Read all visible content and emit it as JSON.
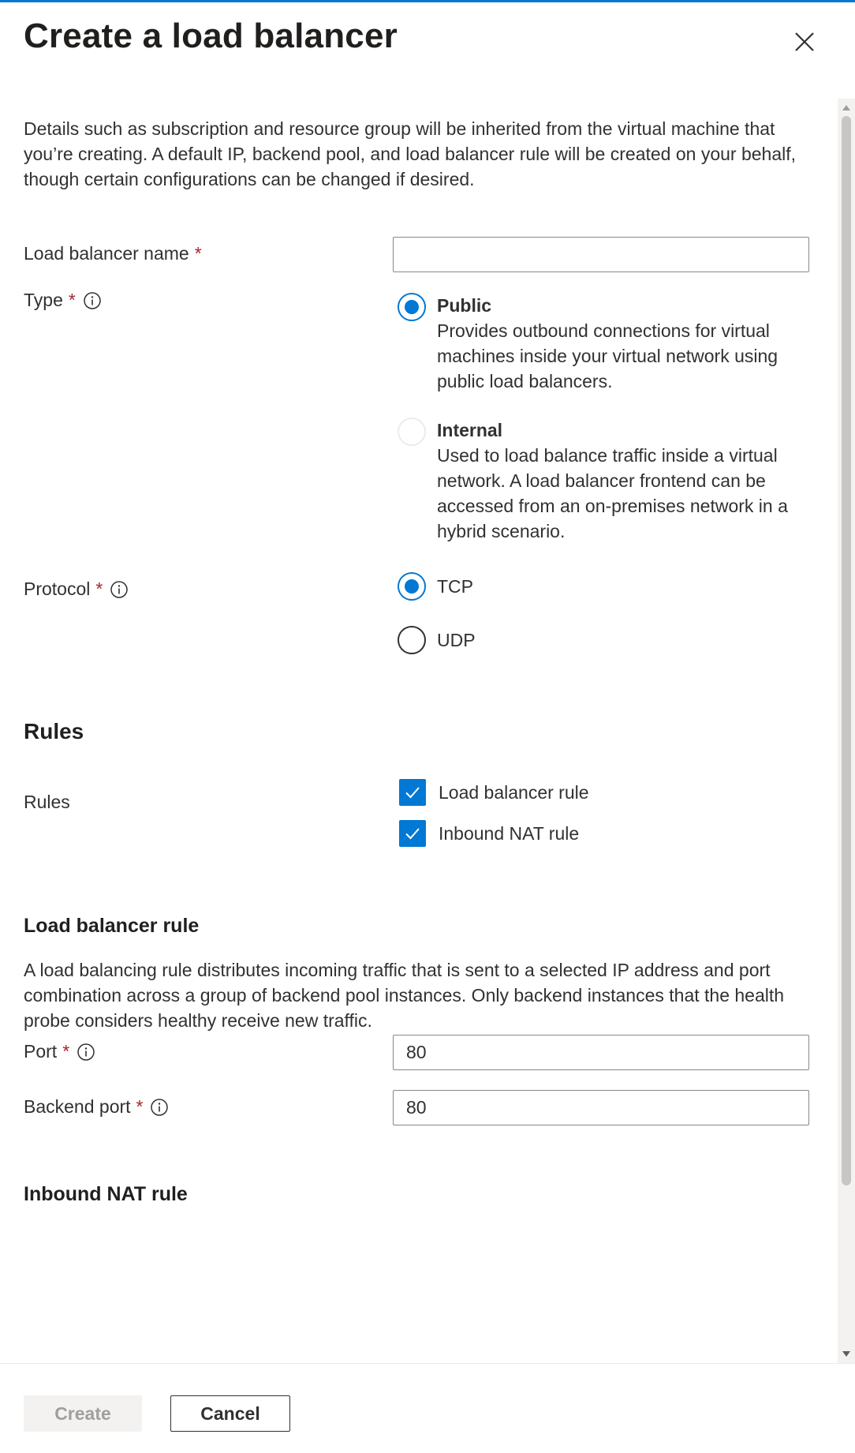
{
  "header": {
    "title": "Create a load balancer",
    "close_icon": "close-icon"
  },
  "intro": "Details such as subscription and resource group will be inherited from the virtual machine that you’re creating. A default IP, backend pool, and load balancer rule will be created on your behalf, though certain configurations can be changed if desired.",
  "form": {
    "name": {
      "label": "Load balancer name",
      "required": "*",
      "value": ""
    },
    "type": {
      "label": "Type",
      "required": "*",
      "info_icon": "info-icon",
      "options": [
        {
          "title": "Public",
          "desc": "Provides outbound connections for virtual machines inside your virtual network using public load balancers.",
          "selected": true
        },
        {
          "title": "Internal",
          "desc": "Used to load balance traffic inside a virtual network. A load balancer frontend can be accessed from an on-premises network in a hybrid scenario.",
          "selected": false
        }
      ]
    },
    "protocol": {
      "label": "Protocol",
      "required": "*",
      "info_icon": "info-icon",
      "options": [
        {
          "label": "TCP",
          "selected": true
        },
        {
          "label": "UDP",
          "selected": false
        }
      ]
    }
  },
  "rules_section": {
    "heading": "Rules",
    "label": "Rules",
    "items": [
      {
        "label": "Load balancer rule",
        "checked": true
      },
      {
        "label": "Inbound NAT rule",
        "checked": true
      }
    ]
  },
  "lb_rule": {
    "heading": "Load balancer rule",
    "desc": "A load balancing rule distributes incoming traffic that is sent to a selected IP address and port combination across a group of backend pool instances. Only backend instances that the health probe considers healthy receive new traffic.",
    "port": {
      "label": "Port",
      "required": "*",
      "value": "80"
    },
    "backend_port": {
      "label": "Backend port",
      "required": "*",
      "value": "80"
    }
  },
  "nat_rule": {
    "heading": "Inbound NAT rule"
  },
  "footer": {
    "create_label": "Create",
    "cancel_label": "Cancel"
  },
  "colors": {
    "accent": "#0078d4",
    "required": "#a4262c",
    "text": "#323130"
  }
}
